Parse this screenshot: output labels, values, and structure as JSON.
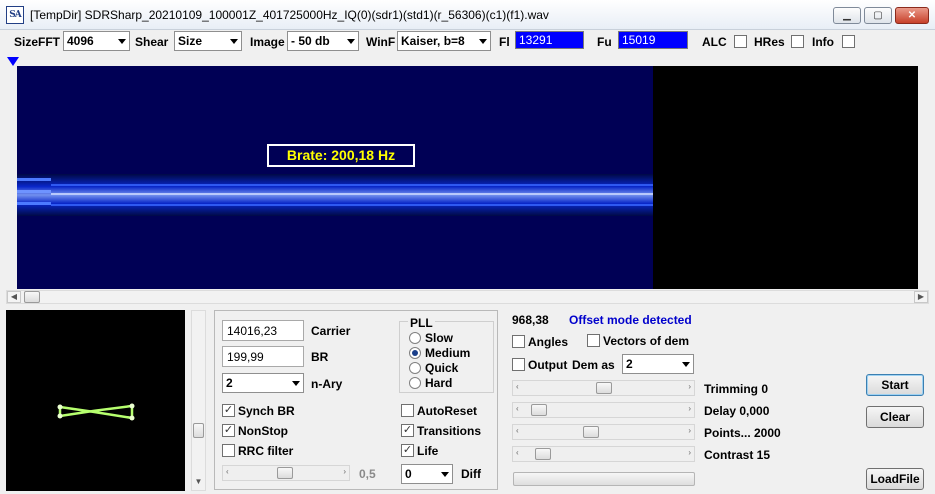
{
  "window": {
    "icon_label": "SA",
    "title": "[TempDir] SDRSharp_20210109_100001Z_401725000Hz_IQ(0)(sdr1)(std1)(r_56306)(c1)(f1).wav",
    "minimize": "▁",
    "maximize": "▢",
    "close": "✕"
  },
  "toolbar": {
    "sizefft_label": "SizeFFT",
    "sizefft_value": "4096",
    "shear_label": "Shear",
    "shear_value": "Size",
    "image_label": "Image",
    "image_value": "- 50 db",
    "winf_label": "WinF",
    "winf_value": "Kaiser, b=8",
    "fl_label": "Fl",
    "fl_value": "13291",
    "fu_label": "Fu",
    "fu_value": "15019",
    "alc_label": "ALC",
    "alc_checked": false,
    "hres_label": "HRes",
    "hres_checked": false,
    "info_label": "Info",
    "info_checked": false
  },
  "spectrum": {
    "brate_label": "Brate: 200,18 Hz",
    "signal_color": "#2f5cff",
    "background_color": "#000055"
  },
  "demod": {
    "carrier_value": "14016,23",
    "carrier_label": "Carrier",
    "br_value": "199,99",
    "br_label": "BR",
    "nary_value": "2",
    "nary_label": "n-Ary",
    "synch_br_label": "Synch BR",
    "synch_br_checked": true,
    "nonstop_label": "NonStop",
    "nonstop_checked": true,
    "rrc_label": "RRC filter",
    "rrc_checked": false,
    "rrc_slider_value": "0,5",
    "autoreset_label": "AutoReset",
    "autoreset_checked": false,
    "transitions_label": "Transitions",
    "transitions_checked": true,
    "life_label": "Life",
    "life_checked": true,
    "diff_value": "0",
    "diff_label": "Diff"
  },
  "pll": {
    "title": "PLL",
    "options": [
      "Slow",
      "Medium",
      "Quick",
      "Hard"
    ],
    "selected": "Medium"
  },
  "right": {
    "freq_value": "968,38",
    "offset_msg": "Offset mode detected",
    "offset_color": "#0000cc",
    "angles_label": "Angles",
    "angles_checked": false,
    "vectors_label": "Vectors of dem",
    "vectors_checked": false,
    "output_label": "Output",
    "output_checked": false,
    "dem_as_label": "Dem as",
    "dem_as_value": "2",
    "trimming_label": "Trimming 0",
    "delay_label": "Delay  0,000",
    "points_label": "Points... 2000",
    "contrast_label": "Contrast 15",
    "start_label": "Start",
    "clear_label": "Clear",
    "loadfile_label": "LoadFile"
  }
}
